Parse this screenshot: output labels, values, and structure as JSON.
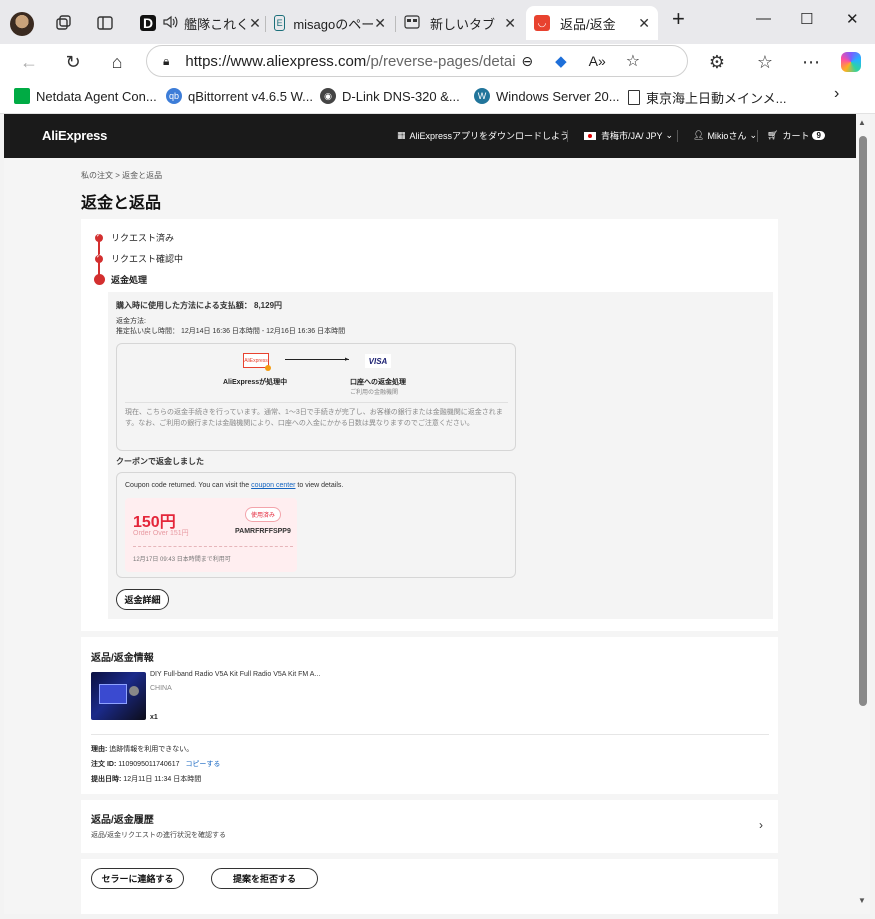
{
  "browser": {
    "tabs": [
      {
        "label": "艦隊これく",
        "icon": "kancolle-icon"
      },
      {
        "label": "misagoのペー",
        "icon": "misago-icon"
      },
      {
        "label": "新しいタブ",
        "icon": "newtab-icon"
      },
      {
        "label": "返品/返金",
        "icon": "aliexpress-icon"
      }
    ],
    "url_host": "https://www.aliexpress.com",
    "url_path": "/p/reverse-pages/detai...",
    "bookmarks": [
      {
        "label": "Netdata Agent Con...",
        "icon": "netdata-icon",
        "color": "#00ab44"
      },
      {
        "label": "qBittorrent v4.6.5 W...",
        "icon": "qbittorrent-icon",
        "color": "#3d7dd8"
      },
      {
        "label": "D-Link DNS-320 &...",
        "icon": "dlink-icon",
        "color": "#444444"
      },
      {
        "label": "Windows Server 20...",
        "icon": "wordpress-icon",
        "color": "#21759b"
      },
      {
        "label": "東京海上日動メインメ...",
        "icon": "page-icon",
        "color": "#ffffff"
      }
    ]
  },
  "header": {
    "logo": "AliExpress",
    "app_download": "AliExpressアプリをダウンロードしよう",
    "locale": "青梅市/JA/ JPY",
    "user": "Mikioさん",
    "cart_label": "カート",
    "cart_count": "9"
  },
  "breadcrumb": "私の注文 > 返金と返品",
  "page_title": "返金と返品",
  "steps": [
    {
      "label": "リクエスト済み"
    },
    {
      "label": "リクエスト確認中"
    },
    {
      "label": "返金処理"
    }
  ],
  "refund": {
    "amount_label": "購入時に使用した方法による支払額：",
    "amount_value": "8,129円",
    "method_label": "返金方法:",
    "eta": "推定払い戻し時間： 12月14日 16:36 日本時間 - 12月16日 16:36 日本時間",
    "from_logo": "AliExpress",
    "from_label": "AliExpressが処理中",
    "to_logo": "VISA",
    "to_label": "口座への返金処理",
    "to_sub": "ご利用の金融機関",
    "note": "現在、こちらの返金手続きを行っています。通常、1〜3日で手続きが完了し、お客様の銀行または金融機関に返金されます。なお、ご利用の銀行または金融機関により、口座への入金にかかる日数は異なりますのでご注意ください。"
  },
  "coupon_section": {
    "title": "クーポンで返金しました",
    "msg_prefix": "Coupon code returned. You can visit the ",
    "msg_link": "coupon center",
    "msg_suffix": " to view details.",
    "amount": "150円",
    "min_order": "Order Over 151円",
    "status": "使用済み",
    "code": "PAMRFRFFSPP9",
    "expiry": "12月17日 09:43 日本時間まで利用可"
  },
  "refund_detail_button": "返金詳細",
  "info": {
    "title": "返品/返金情報",
    "product_name": "DIY Full-band Radio V5A Kit Full Radio V5A Kit FM A...",
    "product_origin": "CHINA",
    "quantity": "x1",
    "reason_label": "理由:",
    "reason_value": "追跡情報を利用できない。",
    "order_label": "注文 ID:",
    "order_value": "1109095011740617",
    "copy_label": "コピーする",
    "submitted_label": "提出日時:",
    "submitted_value": "12月11日 11:34 日本時間"
  },
  "history": {
    "title": "返品/返金履歴",
    "subtitle": "返品/返金リクエストの進行状況を確認する"
  },
  "actions": {
    "contact_seller": "セラーに連絡する",
    "reject_proposal": "提案を拒否する"
  },
  "colors": {
    "accent_red": "#d32f2f",
    "header_bg": "#1a1a1a",
    "link_blue": "#1565c0"
  }
}
